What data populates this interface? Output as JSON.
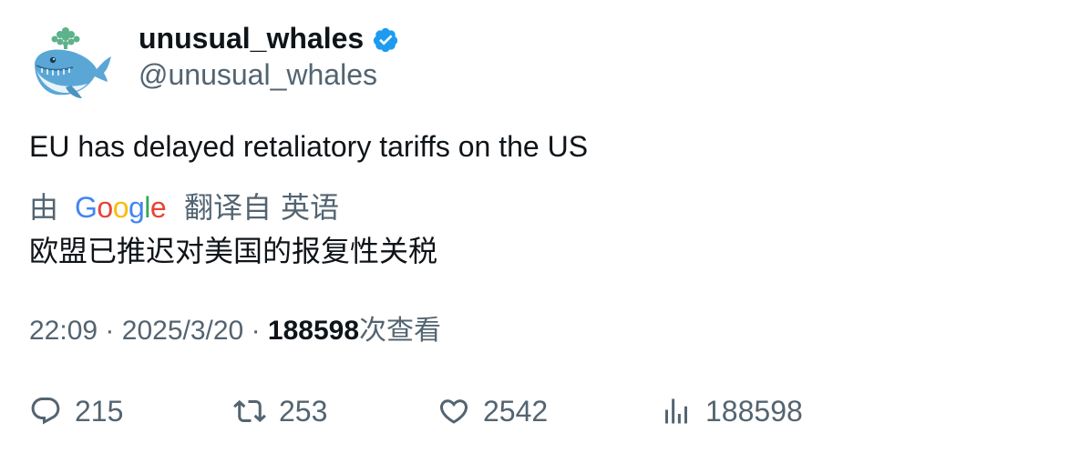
{
  "author": {
    "display_name": "unusual_whales",
    "handle": "@unusual_whales",
    "verified": true,
    "avatar_icon": "whale-icon"
  },
  "tweet": {
    "text": "EU has delayed retaliatory tariffs on the US"
  },
  "translation": {
    "by_label": "由",
    "provider": "Google",
    "translated_from_label": "翻译自",
    "source_language": "英语",
    "translated_text": "欧盟已推迟对美国的报复性关税"
  },
  "meta": {
    "time": "22:09",
    "separator": "·",
    "date": "2025/3/20",
    "views": "188598",
    "views_label": "次查看"
  },
  "actions": {
    "replies": "215",
    "retweets": "253",
    "likes": "2542",
    "views": "188598"
  },
  "colors": {
    "text": "#0f1419",
    "secondary": "#536471",
    "verified": "#1d9bf0"
  }
}
